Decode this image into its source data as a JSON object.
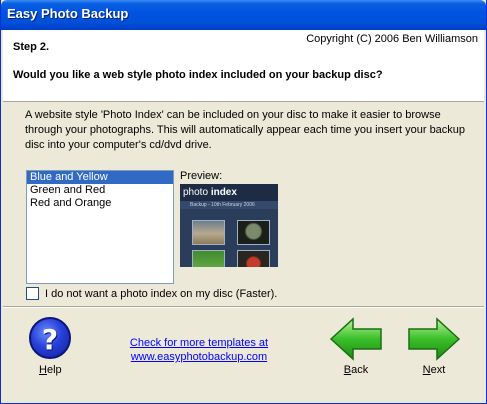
{
  "window": {
    "title": "Easy Photo Backup"
  },
  "header": {
    "copyright": "Copyright (C) 2006 Ben Williamson",
    "step": "Step 2.",
    "question": "Would you like a web style photo index included on your backup disc?"
  },
  "description": "A website style 'Photo Index' can be included on your disc to make it easier to browse through your photographs. This will automatically appear each time you insert your backup disc into your computer's cd/dvd drive.",
  "templates": {
    "items": [
      "Blue and Yellow",
      "Green and Red",
      "Red and Orange"
    ],
    "selected": "Blue and Yellow"
  },
  "preview": {
    "label": "Preview:",
    "index_title_1": "photo ",
    "index_title_2": "index",
    "index_subtitle": "Backup - 10th February 2006"
  },
  "no_index_checkbox": {
    "label": "I do not want a photo index on my disc (Faster).",
    "checked": false
  },
  "help": {
    "label_first": "H",
    "label_rest": "elp"
  },
  "templates_link": {
    "line1": "Check for more templates at",
    "line2": "www.easyphotobackup.com"
  },
  "back": {
    "label_first": "B",
    "label_rest": "ack"
  },
  "next": {
    "label_first": "N",
    "label_rest": "ext"
  },
  "colors": {
    "titlebar": "#0054e3",
    "selection": "#316ac5",
    "arrow_green": "#3bbf2a",
    "help_blue": "#2841d8"
  }
}
